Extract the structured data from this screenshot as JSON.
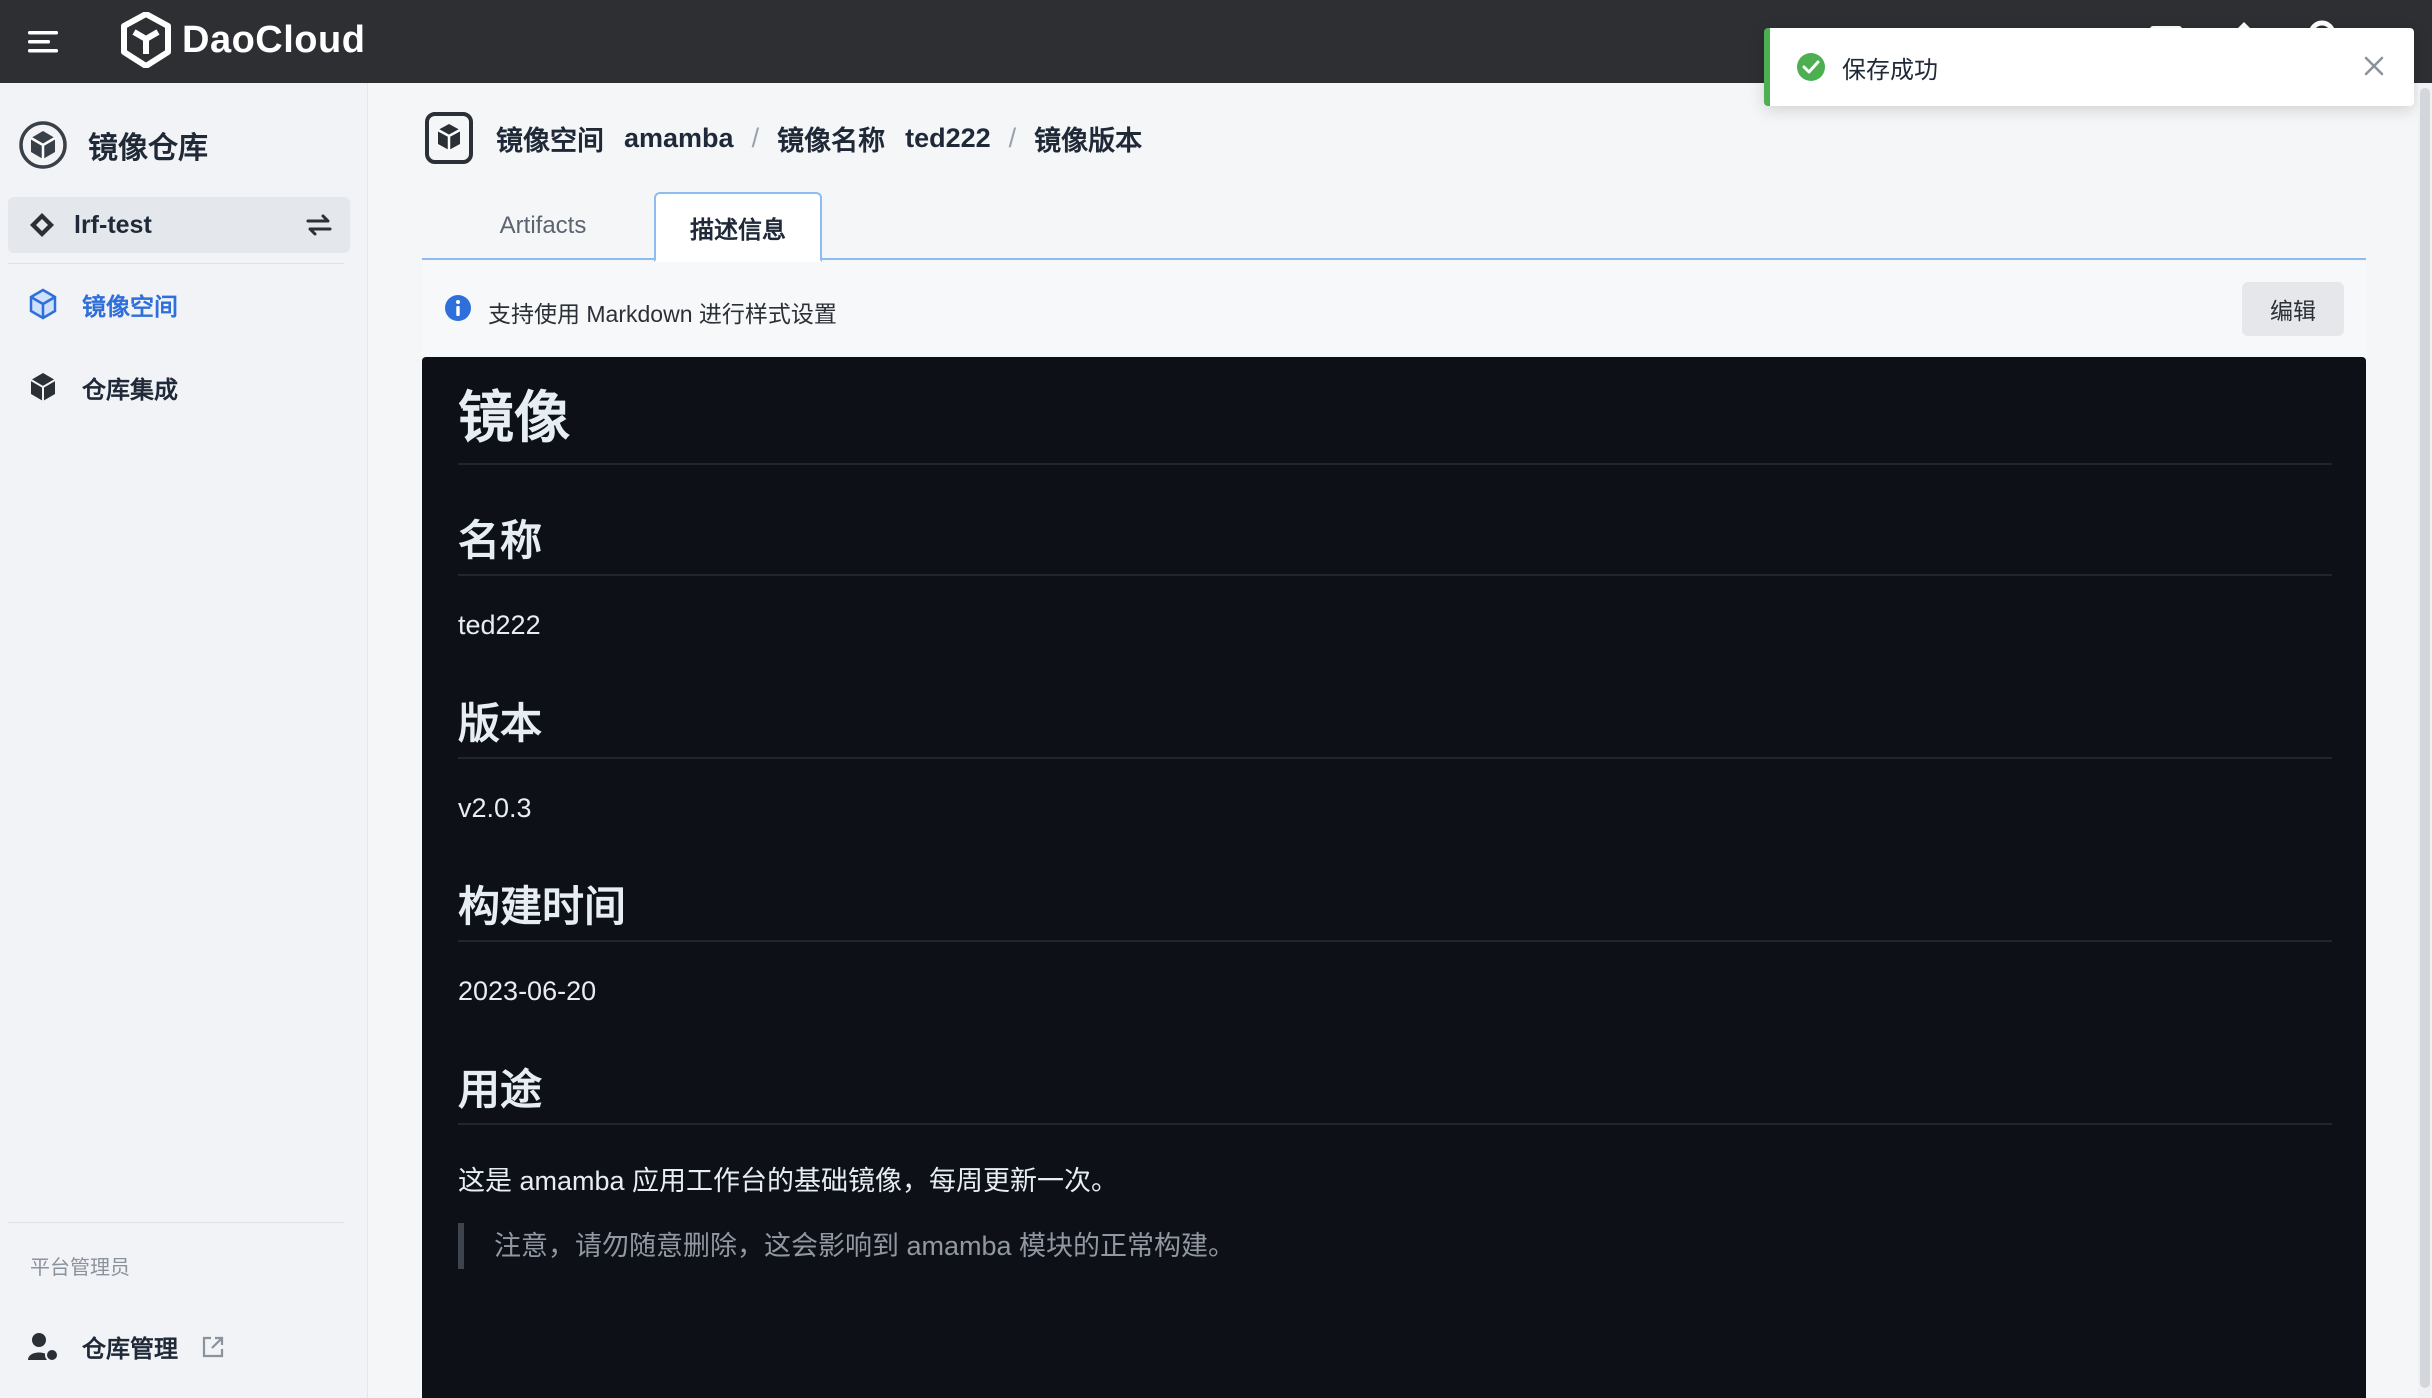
{
  "app": {
    "brand": "DaoCloud"
  },
  "toast": {
    "message": "保存成功"
  },
  "sidebar": {
    "title": "镜像仓库",
    "workspace": "lrf-test",
    "items": [
      {
        "label": "镜像空间",
        "active": true
      },
      {
        "label": "仓库集成",
        "active": false
      }
    ],
    "section_label": "平台管理员",
    "bottom_item": "仓库管理"
  },
  "breadcrumb": {
    "space_label": "镜像空间",
    "space_value": "amamba",
    "name_label": "镜像名称",
    "name_value": "ted222",
    "current": "镜像版本",
    "separator": "/"
  },
  "tabs": [
    {
      "label": "Artifacts",
      "active": false
    },
    {
      "label": "描述信息",
      "active": true
    }
  ],
  "info": {
    "text": "支持使用 Markdown 进行样式设置",
    "edit_label": "编辑"
  },
  "markdown": {
    "h1": "镜像",
    "sections": [
      {
        "heading": "名称",
        "body": "ted222"
      },
      {
        "heading": "版本",
        "body": "v2.0.3"
      },
      {
        "heading": "构建时间",
        "body": "2023-06-20"
      },
      {
        "heading": "用途",
        "body": "这是 amamba 应用工作台的基础镜像，每周更新一次。"
      }
    ],
    "quote": "注意，请勿随意删除，这会影响到 amamba 模块的正常构建。"
  },
  "colors": {
    "topbar": "#2d2f33",
    "accent": "#2f6fdb",
    "success": "#4caf50",
    "markdown_bg": "#0d1117"
  }
}
